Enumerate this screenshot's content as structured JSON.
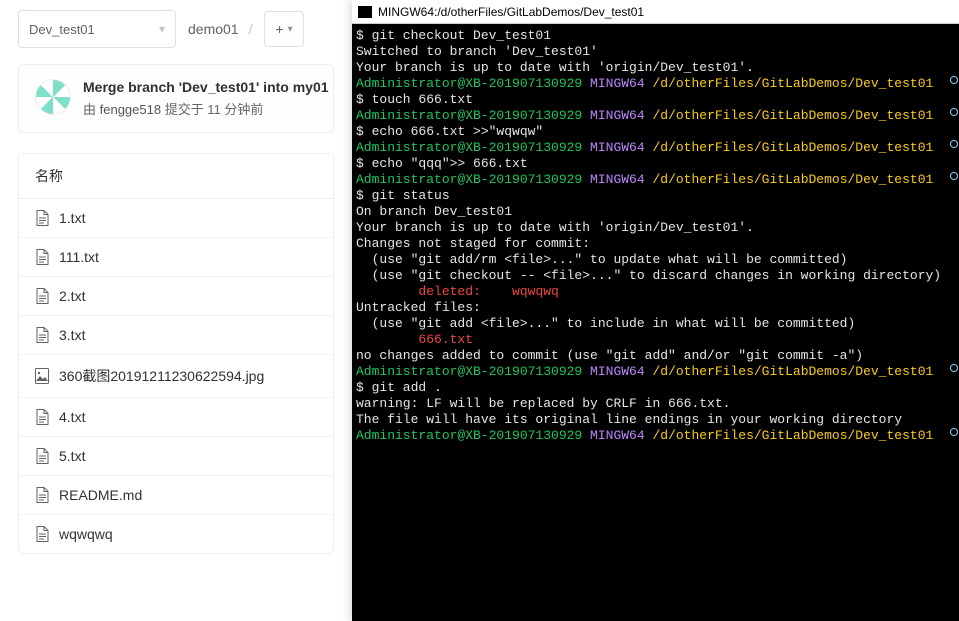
{
  "branchSelect": {
    "value": "Dev_test01"
  },
  "breadcrumb": {
    "item0": "demo01",
    "sep": "/"
  },
  "plusBtn": {
    "label": "+"
  },
  "commit": {
    "message": "Merge branch 'Dev_test01' into my01",
    "byPrefix": "由 ",
    "author": "fengge518",
    "submittedAt": " 提交于 11 分钟前"
  },
  "fileTable": {
    "header": "名称",
    "rows": [
      {
        "name": "1.txt",
        "type": "file"
      },
      {
        "name": "111.txt",
        "type": "file"
      },
      {
        "name": "2.txt",
        "type": "file"
      },
      {
        "name": "3.txt",
        "type": "file"
      },
      {
        "name": "360截图20191211230622594.jpg",
        "type": "image"
      },
      {
        "name": "4.txt",
        "type": "file"
      },
      {
        "name": "5.txt",
        "type": "file"
      },
      {
        "name": "README.md",
        "type": "file"
      },
      {
        "name": "wqwqwq",
        "type": "file"
      }
    ]
  },
  "terminal": {
    "title": "MINGW64:/d/otherFiles/GitLabDemos/Dev_test01",
    "prompt": {
      "user": "Administrator@XB-201907130929",
      "host": "MINGW64",
      "path": "/d/otherFiles/GitLabDemos/Dev_test01"
    },
    "lines": [
      {
        "segs": [
          {
            "t": "$ git checkout Dev_test01",
            "c": "white"
          }
        ]
      },
      {
        "segs": [
          {
            "t": "Switched to branch 'Dev_test01'",
            "c": "white"
          }
        ]
      },
      {
        "segs": [
          {
            "t": "Your branch is up to date with 'origin/Dev_test01'.",
            "c": "white"
          }
        ]
      },
      {
        "segs": [
          {
            "t": "",
            "c": "white"
          }
        ]
      },
      {
        "prompt": true,
        "badge": true
      },
      {
        "segs": [
          {
            "t": "$ touch 666.txt",
            "c": "white"
          }
        ]
      },
      {
        "segs": [
          {
            "t": "",
            "c": "white"
          }
        ]
      },
      {
        "prompt": true,
        "badge": true
      },
      {
        "segs": [
          {
            "t": "$ echo 666.txt >>\"wqwqw\"",
            "c": "white"
          }
        ]
      },
      {
        "segs": [
          {
            "t": "",
            "c": "white"
          }
        ]
      },
      {
        "prompt": true,
        "badge": true
      },
      {
        "segs": [
          {
            "t": "$ echo \"qqq\">> 666.txt",
            "c": "white"
          }
        ]
      },
      {
        "segs": [
          {
            "t": "",
            "c": "white"
          }
        ]
      },
      {
        "prompt": true,
        "badge": true
      },
      {
        "segs": [
          {
            "t": "$ git status",
            "c": "white"
          }
        ]
      },
      {
        "segs": [
          {
            "t": "On branch Dev_test01",
            "c": "white"
          }
        ]
      },
      {
        "segs": [
          {
            "t": "Your branch is up to date with 'origin/Dev_test01'.",
            "c": "white"
          }
        ]
      },
      {
        "segs": [
          {
            "t": "",
            "c": "white"
          }
        ]
      },
      {
        "segs": [
          {
            "t": "Changes not staged for commit:",
            "c": "white"
          }
        ]
      },
      {
        "segs": [
          {
            "t": "  (use \"git add/rm <file>...\" to update what will be committed)",
            "c": "white"
          }
        ]
      },
      {
        "segs": [
          {
            "t": "  (use \"git checkout -- <file>...\" to discard changes in working directory)",
            "c": "white"
          }
        ]
      },
      {
        "segs": [
          {
            "t": "",
            "c": "white"
          }
        ]
      },
      {
        "segs": [
          {
            "t": "        ",
            "c": "white"
          },
          {
            "t": "deleted:    wqwqwq",
            "c": "red"
          }
        ]
      },
      {
        "segs": [
          {
            "t": "",
            "c": "white"
          }
        ]
      },
      {
        "segs": [
          {
            "t": "Untracked files:",
            "c": "white"
          }
        ]
      },
      {
        "segs": [
          {
            "t": "  (use \"git add <file>...\" to include in what will be committed)",
            "c": "white"
          }
        ]
      },
      {
        "segs": [
          {
            "t": "",
            "c": "white"
          }
        ]
      },
      {
        "segs": [
          {
            "t": "        ",
            "c": "white"
          },
          {
            "t": "666.txt",
            "c": "red"
          }
        ]
      },
      {
        "segs": [
          {
            "t": "",
            "c": "white"
          }
        ]
      },
      {
        "segs": [
          {
            "t": "no changes added to commit (use \"git add\" and/or \"git commit -a\")",
            "c": "white"
          }
        ]
      },
      {
        "segs": [
          {
            "t": "",
            "c": "white"
          }
        ]
      },
      {
        "prompt": true,
        "badge": true
      },
      {
        "segs": [
          {
            "t": "$ git add .",
            "c": "white"
          }
        ]
      },
      {
        "segs": [
          {
            "t": "warning: LF will be replaced by CRLF in 666.txt.",
            "c": "white"
          }
        ]
      },
      {
        "segs": [
          {
            "t": "The file will have its original line endings in your working directory",
            "c": "white"
          }
        ]
      },
      {
        "segs": [
          {
            "t": "",
            "c": "white"
          }
        ]
      },
      {
        "prompt": true,
        "badge": true
      }
    ]
  }
}
